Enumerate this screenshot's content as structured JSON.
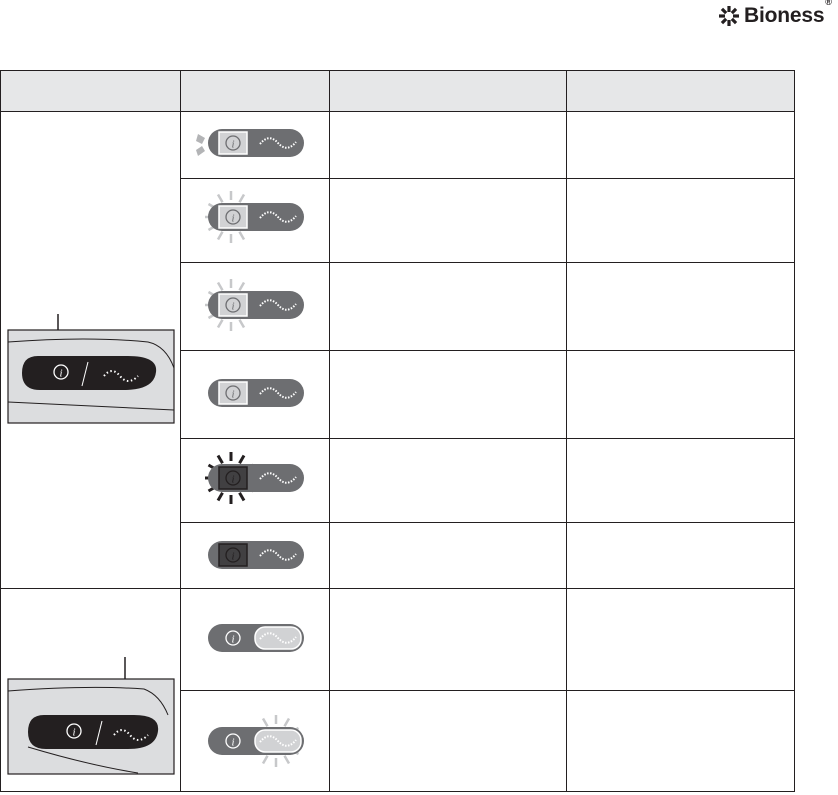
{
  "logo": {
    "text": "Bioness",
    "reg": "®",
    "icon": "bioness-starburst-icon"
  },
  "table": {
    "columns": [
      "",
      "",
      "",
      ""
    ],
    "groups": [
      {
        "name": "status-button-group",
        "illustration": "controller-info-button-highlighted",
        "rows": [
          {
            "indicator": "info-light-blinking-left",
            "meaning": "",
            "action": ""
          },
          {
            "indicator": "info-light-flashing",
            "meaning": "",
            "action": ""
          },
          {
            "indicator": "info-light-flashing",
            "meaning": "",
            "action": ""
          },
          {
            "indicator": "info-light-solid-gray",
            "meaning": "",
            "action": ""
          },
          {
            "indicator": "info-light-dark-flashing",
            "meaning": "",
            "action": ""
          },
          {
            "indicator": "info-light-solid-dark",
            "meaning": "",
            "action": ""
          }
        ]
      },
      {
        "name": "stimulation-button-group",
        "illustration": "controller-stim-button-highlighted",
        "rows": [
          {
            "indicator": "stim-light-solid",
            "meaning": "",
            "action": ""
          },
          {
            "indicator": "stim-light-flashing",
            "meaning": "",
            "action": ""
          }
        ]
      }
    ]
  },
  "colors": {
    "header_bg": "#e6e7e8",
    "pill_dark": "#6d6e71",
    "info_segment_light": "#d1d2d4",
    "info_segment_dark": "#414042",
    "illustration_bg": "#dcdddf",
    "device_black": "#231f20"
  }
}
